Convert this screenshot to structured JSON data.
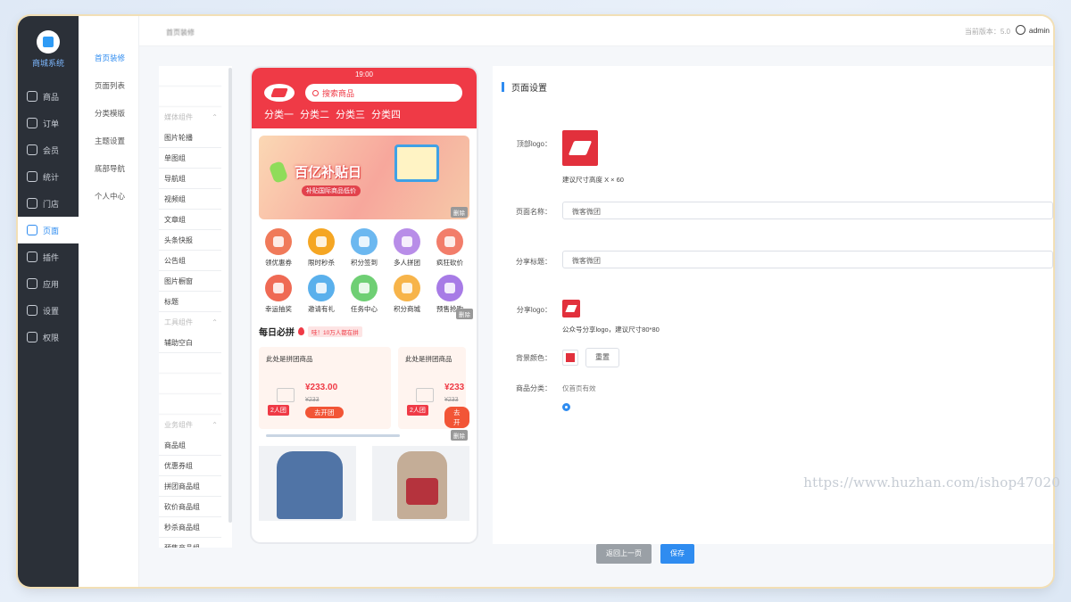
{
  "sidebar": {
    "brand": "商城系统",
    "items": [
      {
        "label": "商品",
        "icon": "layers-icon"
      },
      {
        "label": "订单",
        "icon": "order-icon"
      },
      {
        "label": "会员",
        "icon": "vip-icon"
      },
      {
        "label": "统计",
        "icon": "chart-icon"
      },
      {
        "label": "门店",
        "icon": "store-icon"
      },
      {
        "label": "页面",
        "icon": "page-icon",
        "active": true
      },
      {
        "label": "插件",
        "icon": "plugin-icon"
      },
      {
        "label": "应用",
        "icon": "apps-icon"
      },
      {
        "label": "设置",
        "icon": "gear-icon"
      },
      {
        "label": "权限",
        "icon": "shield-icon"
      }
    ]
  },
  "submenu": {
    "items": [
      "首页装修",
      "页面列表",
      "分类模版",
      "主题设置",
      "底部导航",
      "个人中心"
    ],
    "active_index": 0
  },
  "topbar": {
    "breadcrumb": "首页装修",
    "version": "当前版本：5.0",
    "user": "admin"
  },
  "components": {
    "items": [
      {
        "type": "item",
        "label": "",
        "blur": true
      },
      {
        "type": "item",
        "label": "",
        "blur": true
      },
      {
        "type": "group",
        "label": "媒体组件"
      },
      {
        "type": "item",
        "label": "图片轮播"
      },
      {
        "type": "item",
        "label": "单图组"
      },
      {
        "type": "item",
        "label": "导航组"
      },
      {
        "type": "item",
        "label": "视频组"
      },
      {
        "type": "item",
        "label": "文章组"
      },
      {
        "type": "item",
        "label": "头条快报"
      },
      {
        "type": "item",
        "label": "公告组"
      },
      {
        "type": "item",
        "label": "图片橱窗"
      },
      {
        "type": "item",
        "label": "标题"
      },
      {
        "type": "group",
        "label": "工具组件"
      },
      {
        "type": "item",
        "label": "辅助空白"
      },
      {
        "type": "item",
        "label": "",
        "blur": true
      },
      {
        "type": "item",
        "label": "",
        "blur": true
      },
      {
        "type": "item",
        "label": "",
        "blur": true
      },
      {
        "type": "group",
        "label": "业务组件"
      },
      {
        "type": "item",
        "label": "商品组"
      },
      {
        "type": "item",
        "label": "优惠券组"
      },
      {
        "type": "item",
        "label": "拼团商品组"
      },
      {
        "type": "item",
        "label": "砍价商品组"
      },
      {
        "type": "item",
        "label": "秒杀商品组"
      },
      {
        "type": "item",
        "label": "预售商品组"
      }
    ]
  },
  "phone": {
    "time": "19:00",
    "search_placeholder": "搜索商品",
    "categories": [
      "分类一",
      "分类二",
      "分类三",
      "分类四"
    ],
    "banner": {
      "title": "百亿补贴日",
      "subtitle": "补贴国际商品低价"
    },
    "delete_label": "删除",
    "grid": [
      {
        "label": "领优惠券",
        "color": "#f07a5a"
      },
      {
        "label": "限时秒杀",
        "color": "#f5a623"
      },
      {
        "label": "积分签到",
        "color": "#6cb8f0"
      },
      {
        "label": "多人拼团",
        "color": "#b88de8"
      },
      {
        "label": "疯狂砍价",
        "color": "#f27d6a"
      },
      {
        "label": "幸运抽奖",
        "color": "#ef6a54"
      },
      {
        "label": "邀请有礼",
        "color": "#5ab0ec"
      },
      {
        "label": "任务中心",
        "color": "#6fcf74"
      },
      {
        "label": "积分商城",
        "color": "#f7b44a"
      },
      {
        "label": "预售抢购",
        "color": "#a77be6"
      }
    ],
    "daily": {
      "title": "每日必拼",
      "badge": "哇！10万人都在拼",
      "deals": [
        {
          "name": "此处是拼团商品",
          "price": "¥233.00",
          "old": "¥233",
          "team": "2人团",
          "button": "去开团"
        },
        {
          "name": "此处是拼团商品",
          "price": "¥233",
          "old": "¥233",
          "team": "2人团",
          "button": "去开"
        }
      ]
    }
  },
  "settings": {
    "title": "页面设置",
    "title_hint": "",
    "rows": {
      "title_label": "",
      "logo_label": "顶部logo：",
      "logo_hint": "建议尺寸高度 X × 60",
      "name_label": "页面名称：",
      "name_value": "微客微团",
      "name_hint": "",
      "share_title_label": "分享标题：",
      "share_title_value": "微客微团",
      "share_title_hint": "",
      "share_logo_label": "分享logo：",
      "share_logo_hint": "公众号分享logo，建议尺寸80*80",
      "bg_label": "背景颜色：",
      "bg_color": "#e2303c",
      "reset": "重置",
      "category_label": "商品分类：",
      "category_note": "仅首页有效",
      "radio_label": "",
      "last_label": ""
    }
  },
  "watermark": "https://www.huzhan.com/ishop47020",
  "footer": {
    "back": "返回上一页",
    "save": "保存"
  },
  "colors": {
    "accent": "#2f8cf0",
    "brand_red": "#ef3a46",
    "sidebar_bg": "#2b3038"
  }
}
